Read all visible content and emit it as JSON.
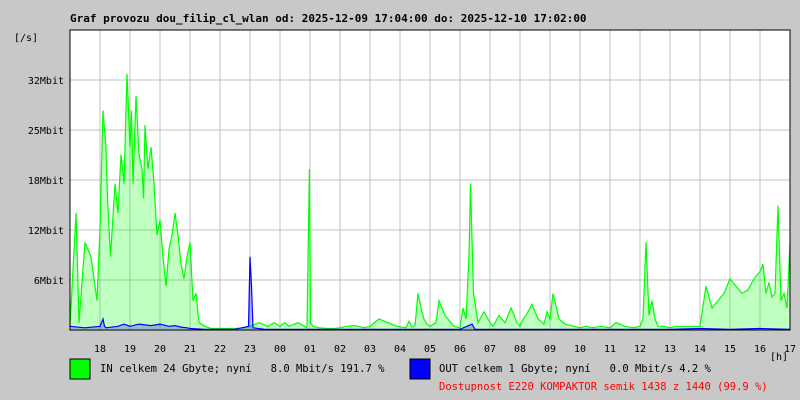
{
  "chart_data": {
    "type": "area",
    "title": "Graf provozu dou_filip_cl_wlan od: 2025-12-09 17:04:00 do: 2025-12-10 17:02:00",
    "ylabel": "[/s]",
    "xlabel": "[h]",
    "ylim": [
      0,
      41
    ],
    "xlim": [
      17,
      41
    ],
    "grid": true,
    "y_ticks": [
      {
        "value": 6.83,
        "label": "6Mbit"
      },
      {
        "value": 13.67,
        "label": "12Mbit"
      },
      {
        "value": 20.5,
        "label": "18Mbit"
      },
      {
        "value": 27.33,
        "label": "25Mbit"
      },
      {
        "value": 34.17,
        "label": "32Mbit"
      }
    ],
    "x_ticks": [
      {
        "value": 18,
        "label": "18"
      },
      {
        "value": 19,
        "label": "19"
      },
      {
        "value": 20,
        "label": "20"
      },
      {
        "value": 21,
        "label": "21"
      },
      {
        "value": 22,
        "label": "22"
      },
      {
        "value": 23,
        "label": "23"
      },
      {
        "value": 24,
        "label": "00"
      },
      {
        "value": 25,
        "label": "01"
      },
      {
        "value": 26,
        "label": "02"
      },
      {
        "value": 27,
        "label": "03"
      },
      {
        "value": 28,
        "label": "04"
      },
      {
        "value": 29,
        "label": "05"
      },
      {
        "value": 30,
        "label": "06"
      },
      {
        "value": 31,
        "label": "07"
      },
      {
        "value": 32,
        "label": "08"
      },
      {
        "value": 33,
        "label": "09"
      },
      {
        "value": 34,
        "label": "10"
      },
      {
        "value": 35,
        "label": "11"
      },
      {
        "value": 36,
        "label": "12"
      },
      {
        "value": 37,
        "label": "13"
      },
      {
        "value": 38,
        "label": "14"
      },
      {
        "value": 39,
        "label": "15"
      },
      {
        "value": 40,
        "label": "16"
      },
      {
        "value": 41,
        "label": "17"
      }
    ],
    "series": [
      {
        "name": "IN",
        "color": "#00ff00",
        "x": [
          17.0,
          17.2,
          17.3,
          17.5,
          17.7,
          17.9,
          18.0,
          18.1,
          18.2,
          18.25,
          18.35,
          18.5,
          18.6,
          18.7,
          18.8,
          18.9,
          19.0,
          19.05,
          19.1,
          19.2,
          19.3,
          19.4,
          19.45,
          19.5,
          19.6,
          19.7,
          19.8,
          19.9,
          20.0,
          20.1,
          20.2,
          20.3,
          20.4,
          20.5,
          20.6,
          20.7,
          20.8,
          20.9,
          21.0,
          21.1,
          21.2,
          21.3,
          21.5,
          21.7,
          21.9,
          22.2,
          22.5,
          22.8,
          23.0,
          23.3,
          23.6,
          23.8,
          24.0,
          24.15,
          24.3,
          24.6,
          24.9,
          24.98,
          25.02,
          25.1,
          25.3,
          25.6,
          25.8,
          26.0,
          26.2,
          26.5,
          26.8,
          27.0,
          27.3,
          27.6,
          27.9,
          28.2,
          28.3,
          28.4,
          28.5,
          28.6,
          28.7,
          28.8,
          28.9,
          29.0,
          29.2,
          29.3,
          29.5,
          29.8,
          30.0,
          30.1,
          30.2,
          30.3,
          30.35,
          30.45,
          30.6,
          30.8,
          31.0,
          31.1,
          31.3,
          31.5,
          31.7,
          31.9,
          32.0,
          32.1,
          32.2,
          32.4,
          32.6,
          32.8,
          32.9,
          33.0,
          33.1,
          33.3,
          33.5,
          33.8,
          34.0,
          34.2,
          34.4,
          34.7,
          35.0,
          35.2,
          35.5,
          35.8,
          36.0,
          36.1,
          36.2,
          36.3,
          36.4,
          36.5,
          36.6,
          36.8,
          37.0,
          37.2,
          37.5,
          37.8,
          38.0,
          38.2,
          38.4,
          38.6,
          38.8,
          39.0,
          39.2,
          39.4,
          39.6,
          39.8,
          40.0,
          40.1,
          40.2,
          40.3,
          40.4,
          40.5,
          40.6,
          40.7,
          40.8,
          40.9,
          41.0
        ],
        "values": [
          0.5,
          16.0,
          1.0,
          12.0,
          10.0,
          4.0,
          14.0,
          30.0,
          25.0,
          18.0,
          10.0,
          20.0,
          16.0,
          24.0,
          20.0,
          35.0,
          25.0,
          30.0,
          20.0,
          32.0,
          24.0,
          22.0,
          18.0,
          28.0,
          22.0,
          25.0,
          20.0,
          13.0,
          15.0,
          10.0,
          6.0,
          11.0,
          13.0,
          16.0,
          13.0,
          9.0,
          7.0,
          10.0,
          12.0,
          4.0,
          5.0,
          1.0,
          0.5,
          0.2,
          0.2,
          0.2,
          0.2,
          0.3,
          0.5,
          1.0,
          0.5,
          1.0,
          0.5,
          1.0,
          0.5,
          1.0,
          0.3,
          22.0,
          1.0,
          0.5,
          0.3,
          0.2,
          0.2,
          0.3,
          0.5,
          0.6,
          0.3,
          0.5,
          1.5,
          1.0,
          0.5,
          0.3,
          1.2,
          0.4,
          0.6,
          5.0,
          3.0,
          1.5,
          0.8,
          0.5,
          1.0,
          4.0,
          2.0,
          0.5,
          0.3,
          3.0,
          1.5,
          10.0,
          20.0,
          5.0,
          1.0,
          2.5,
          1.0,
          0.5,
          2.0,
          1.0,
          3.0,
          1.0,
          0.5,
          1.5,
          2.0,
          3.5,
          1.5,
          0.8,
          2.5,
          1.5,
          5.0,
          1.5,
          0.8,
          0.5,
          0.3,
          0.5,
          0.3,
          0.5,
          0.3,
          1.0,
          0.5,
          0.3,
          0.5,
          1.5,
          12.0,
          2.0,
          4.0,
          1.5,
          0.5,
          0.5,
          0.3,
          0.5,
          0.5,
          0.5,
          0.5,
          6.0,
          3.0,
          4.0,
          5.0,
          7.0,
          6.0,
          5.0,
          5.5,
          7.0,
          8.0,
          9.0,
          5.0,
          6.5,
          4.5,
          5.0,
          17.0,
          4.0,
          5.0,
          3.0,
          12.0
        ]
      },
      {
        "name": "OUT",
        "color": "#0000ff",
        "x": [
          17.0,
          17.5,
          18.0,
          18.1,
          18.15,
          18.2,
          18.6,
          18.8,
          19.0,
          19.3,
          19.7,
          20.0,
          20.3,
          20.5,
          20.7,
          20.9,
          21.0,
          21.5,
          22.0,
          22.5,
          22.95,
          23.0,
          23.05,
          23.1,
          23.5,
          24.0,
          25.0,
          26.0,
          27.0,
          28.0,
          29.0,
          30.0,
          30.4,
          30.5,
          31.0,
          32.0,
          33.0,
          34.0,
          35.0,
          36.0,
          37.0,
          38.0,
          39.0,
          40.0,
          41.0
        ],
        "values": [
          0.5,
          0.3,
          0.5,
          1.5,
          0.5,
          0.3,
          0.5,
          0.8,
          0.5,
          0.8,
          0.6,
          0.8,
          0.5,
          0.6,
          0.4,
          0.3,
          0.2,
          0.1,
          0.1,
          0.1,
          0.5,
          10.0,
          6.0,
          0.3,
          0.1,
          0.1,
          0.1,
          0.1,
          0.1,
          0.1,
          0.1,
          0.1,
          0.8,
          0.1,
          0.1,
          0.1,
          0.1,
          0.1,
          0.1,
          0.1,
          0.1,
          0.2,
          0.1,
          0.2,
          0.1
        ]
      }
    ]
  },
  "legend": {
    "in_color": "#00ff00",
    "in_text": "IN celkem 24 Gbyte; nyní   8.0 Mbit/s 191.7 %",
    "out_color": "#0000ff",
    "out_text": "OUT celkem 1 Gbyte; nyní   0.0 Mbit/s 4.2 %",
    "availability_text": "Dostupnost E220 KOMPAKTOR semik 1438 z 1440 (99.9 %)",
    "availability_color": "#ff0000"
  }
}
